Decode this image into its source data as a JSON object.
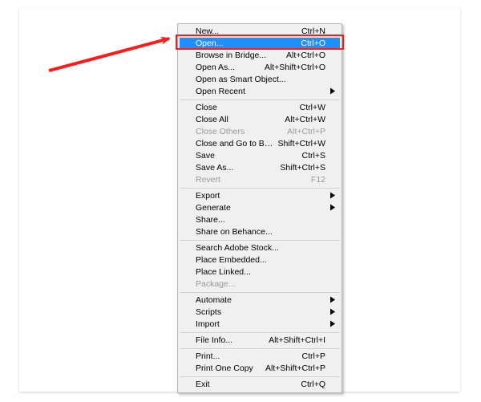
{
  "annotation": {
    "arrow_color": "#ff1a1a",
    "box_color": "#ff1a1a"
  },
  "menu": {
    "groups": [
      [
        {
          "id": "new",
          "label": "New...",
          "shortcut": "Ctrl+N",
          "submenu": false,
          "disabled": false,
          "selected": false
        },
        {
          "id": "open",
          "label": "Open...",
          "shortcut": "Ctrl+O",
          "submenu": false,
          "disabled": false,
          "selected": true
        },
        {
          "id": "browse-in-bridge",
          "label": "Browse in Bridge...",
          "shortcut": "Alt+Ctrl+O",
          "submenu": false,
          "disabled": false,
          "selected": false
        },
        {
          "id": "open-as",
          "label": "Open As...",
          "shortcut": "Alt+Shift+Ctrl+O",
          "submenu": false,
          "disabled": false,
          "selected": false
        },
        {
          "id": "open-as-smart-object",
          "label": "Open as Smart Object...",
          "shortcut": "",
          "submenu": false,
          "disabled": false,
          "selected": false
        },
        {
          "id": "open-recent",
          "label": "Open Recent",
          "shortcut": "",
          "submenu": true,
          "disabled": false,
          "selected": false
        }
      ],
      [
        {
          "id": "close",
          "label": "Close",
          "shortcut": "Ctrl+W",
          "submenu": false,
          "disabled": false,
          "selected": false
        },
        {
          "id": "close-all",
          "label": "Close All",
          "shortcut": "Alt+Ctrl+W",
          "submenu": false,
          "disabled": false,
          "selected": false
        },
        {
          "id": "close-others",
          "label": "Close Others",
          "shortcut": "Alt+Ctrl+P",
          "submenu": false,
          "disabled": true,
          "selected": false
        },
        {
          "id": "close-and-go-to-bridge",
          "label": "Close and Go to Bridge...",
          "shortcut": "Shift+Ctrl+W",
          "submenu": false,
          "disabled": false,
          "selected": false
        },
        {
          "id": "save",
          "label": "Save",
          "shortcut": "Ctrl+S",
          "submenu": false,
          "disabled": false,
          "selected": false
        },
        {
          "id": "save-as",
          "label": "Save As...",
          "shortcut": "Shift+Ctrl+S",
          "submenu": false,
          "disabled": false,
          "selected": false
        },
        {
          "id": "revert",
          "label": "Revert",
          "shortcut": "F12",
          "submenu": false,
          "disabled": true,
          "selected": false
        }
      ],
      [
        {
          "id": "export",
          "label": "Export",
          "shortcut": "",
          "submenu": true,
          "disabled": false,
          "selected": false
        },
        {
          "id": "generate",
          "label": "Generate",
          "shortcut": "",
          "submenu": true,
          "disabled": false,
          "selected": false
        },
        {
          "id": "share",
          "label": "Share...",
          "shortcut": "",
          "submenu": false,
          "disabled": false,
          "selected": false
        },
        {
          "id": "share-on-behance",
          "label": "Share on Behance...",
          "shortcut": "",
          "submenu": false,
          "disabled": false,
          "selected": false
        }
      ],
      [
        {
          "id": "search-adobe-stock",
          "label": "Search Adobe Stock...",
          "shortcut": "",
          "submenu": false,
          "disabled": false,
          "selected": false
        },
        {
          "id": "place-embedded",
          "label": "Place Embedded...",
          "shortcut": "",
          "submenu": false,
          "disabled": false,
          "selected": false
        },
        {
          "id": "place-linked",
          "label": "Place Linked...",
          "shortcut": "",
          "submenu": false,
          "disabled": false,
          "selected": false
        },
        {
          "id": "package",
          "label": "Package...",
          "shortcut": "",
          "submenu": false,
          "disabled": true,
          "selected": false
        }
      ],
      [
        {
          "id": "automate",
          "label": "Automate",
          "shortcut": "",
          "submenu": true,
          "disabled": false,
          "selected": false
        },
        {
          "id": "scripts",
          "label": "Scripts",
          "shortcut": "",
          "submenu": true,
          "disabled": false,
          "selected": false
        },
        {
          "id": "import",
          "label": "Import",
          "shortcut": "",
          "submenu": true,
          "disabled": false,
          "selected": false
        }
      ],
      [
        {
          "id": "file-info",
          "label": "File Info...",
          "shortcut": "Alt+Shift+Ctrl+I",
          "submenu": false,
          "disabled": false,
          "selected": false
        }
      ],
      [
        {
          "id": "print",
          "label": "Print...",
          "shortcut": "Ctrl+P",
          "submenu": false,
          "disabled": false,
          "selected": false
        },
        {
          "id": "print-one-copy",
          "label": "Print One Copy",
          "shortcut": "Alt+Shift+Ctrl+P",
          "submenu": false,
          "disabled": false,
          "selected": false
        }
      ],
      [
        {
          "id": "exit",
          "label": "Exit",
          "shortcut": "Ctrl+Q",
          "submenu": false,
          "disabled": false,
          "selected": false
        }
      ]
    ]
  }
}
